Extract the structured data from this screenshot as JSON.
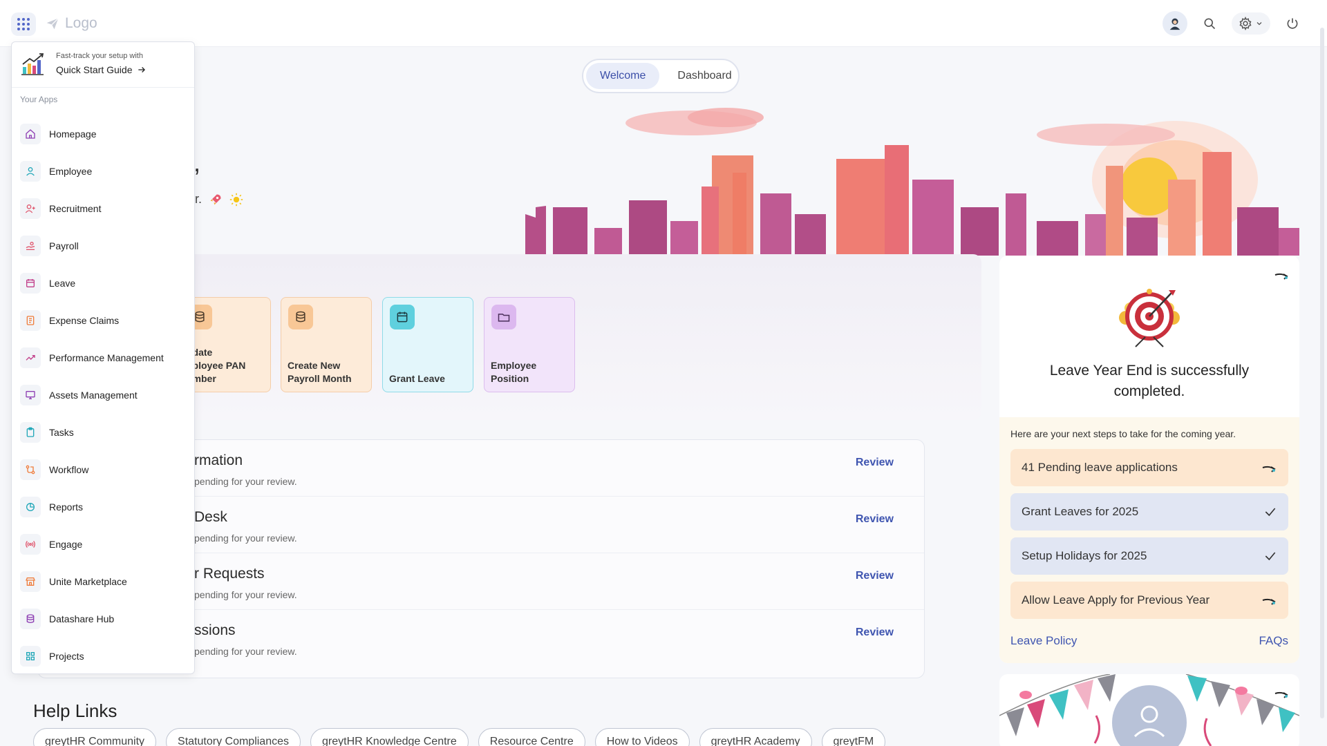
{
  "topbar": {
    "logo_text": "Logo",
    "icons": [
      "apps-grid-icon",
      "user-avatar-icon",
      "search-icon",
      "gear-icon",
      "chevron-down-icon",
      "power-icon"
    ]
  },
  "toggle": {
    "welcome": "Welcome",
    "dashboard": "Dashboard"
  },
  "hero": {
    "greeting_fragment": "on,",
    "subline_fragment": "r."
  },
  "quick_actions": [
    {
      "label": "pdate\nnployee PAN\number",
      "line1": "pdate",
      "line2": "nployee PAN",
      "line3": "umber",
      "color": "orange",
      "icon": "database-icon"
    },
    {
      "label": "Create New Payroll Month",
      "line1": "Create New",
      "line2": "Payroll Month",
      "color": "orange",
      "icon": "database-icon"
    },
    {
      "label": "Grant Leave",
      "color": "cyan",
      "icon": "calendar-icon"
    },
    {
      "label": "Employee Position",
      "line1": "Employee",
      "line2": "Position",
      "color": "purple",
      "icon": "folder-icon"
    }
  ],
  "reviews": [
    {
      "title": "rmation",
      "sub": "pending for your review.",
      "link": "Review"
    },
    {
      "title": "Desk",
      "sub": "pending for your review.",
      "link": "Review"
    },
    {
      "title": "r Requests",
      "sub": "pending for your review.",
      "link": "Review"
    },
    {
      "title": "ssions",
      "sub": "pending for your review.",
      "link": "Review"
    }
  ],
  "help": {
    "title": "Help Links",
    "links": [
      "greytHR Community",
      "Statutory Compliances",
      "greytHR Knowledge Centre",
      "Resource Centre",
      "How to Videos",
      "greytHR Academy",
      "greytFM"
    ]
  },
  "leave_card": {
    "title": "Leave Year End is successfully completed.",
    "intro": "Here are your next steps to take for the coming year.",
    "steps": [
      {
        "label": "41 Pending leave applications",
        "status": "pending"
      },
      {
        "label": "Grant Leaves for 2025",
        "status": "done"
      },
      {
        "label": "Setup Holidays for 2025",
        "status": "done"
      },
      {
        "label": "Allow Leave Apply for Previous Year",
        "status": "pending"
      }
    ],
    "footer_left": "Leave Policy",
    "footer_right": "FAQs"
  },
  "app_menu": {
    "quick_start_sub": "Fast-track your setup with",
    "quick_start_main": "Quick Start Guide",
    "section_label": "Your Apps",
    "items": [
      {
        "label": "Homepage",
        "icon": "home-icon",
        "color": "#8e3fb3"
      },
      {
        "label": "Employee",
        "icon": "user-icon",
        "color": "#20a7b8"
      },
      {
        "label": "Recruitment",
        "icon": "user-plus-icon",
        "color": "#e0566d"
      },
      {
        "label": "Payroll",
        "icon": "payroll-icon",
        "color": "#e0566d"
      },
      {
        "label": "Leave",
        "icon": "calendar-icon",
        "color": "#c23f8a"
      },
      {
        "label": "Expense Claims",
        "icon": "receipt-icon",
        "color": "#ef7d3c"
      },
      {
        "label": "Performance Management",
        "icon": "trend-icon",
        "color": "#c23f8a"
      },
      {
        "label": "Assets Management",
        "icon": "monitor-icon",
        "color": "#8e3fb3"
      },
      {
        "label": "Tasks",
        "icon": "clipboard-icon",
        "color": "#20a7b8"
      },
      {
        "label": "Workflow",
        "icon": "workflow-icon",
        "color": "#ef7d3c"
      },
      {
        "label": "Reports",
        "icon": "pie-icon",
        "color": "#20a7b8"
      },
      {
        "label": "Engage",
        "icon": "broadcast-icon",
        "color": "#e0566d"
      },
      {
        "label": "Unite Marketplace",
        "icon": "store-icon",
        "color": "#ef7d3c"
      },
      {
        "label": "Datashare Hub",
        "icon": "database-icon",
        "color": "#8e3fb3"
      },
      {
        "label": "Projects",
        "icon": "grid-icon",
        "color": "#20a7b8"
      }
    ]
  },
  "colors": {
    "accent": "#3f55b0",
    "pending_step": "#fde7d0",
    "done_step": "#e1e6f3"
  }
}
